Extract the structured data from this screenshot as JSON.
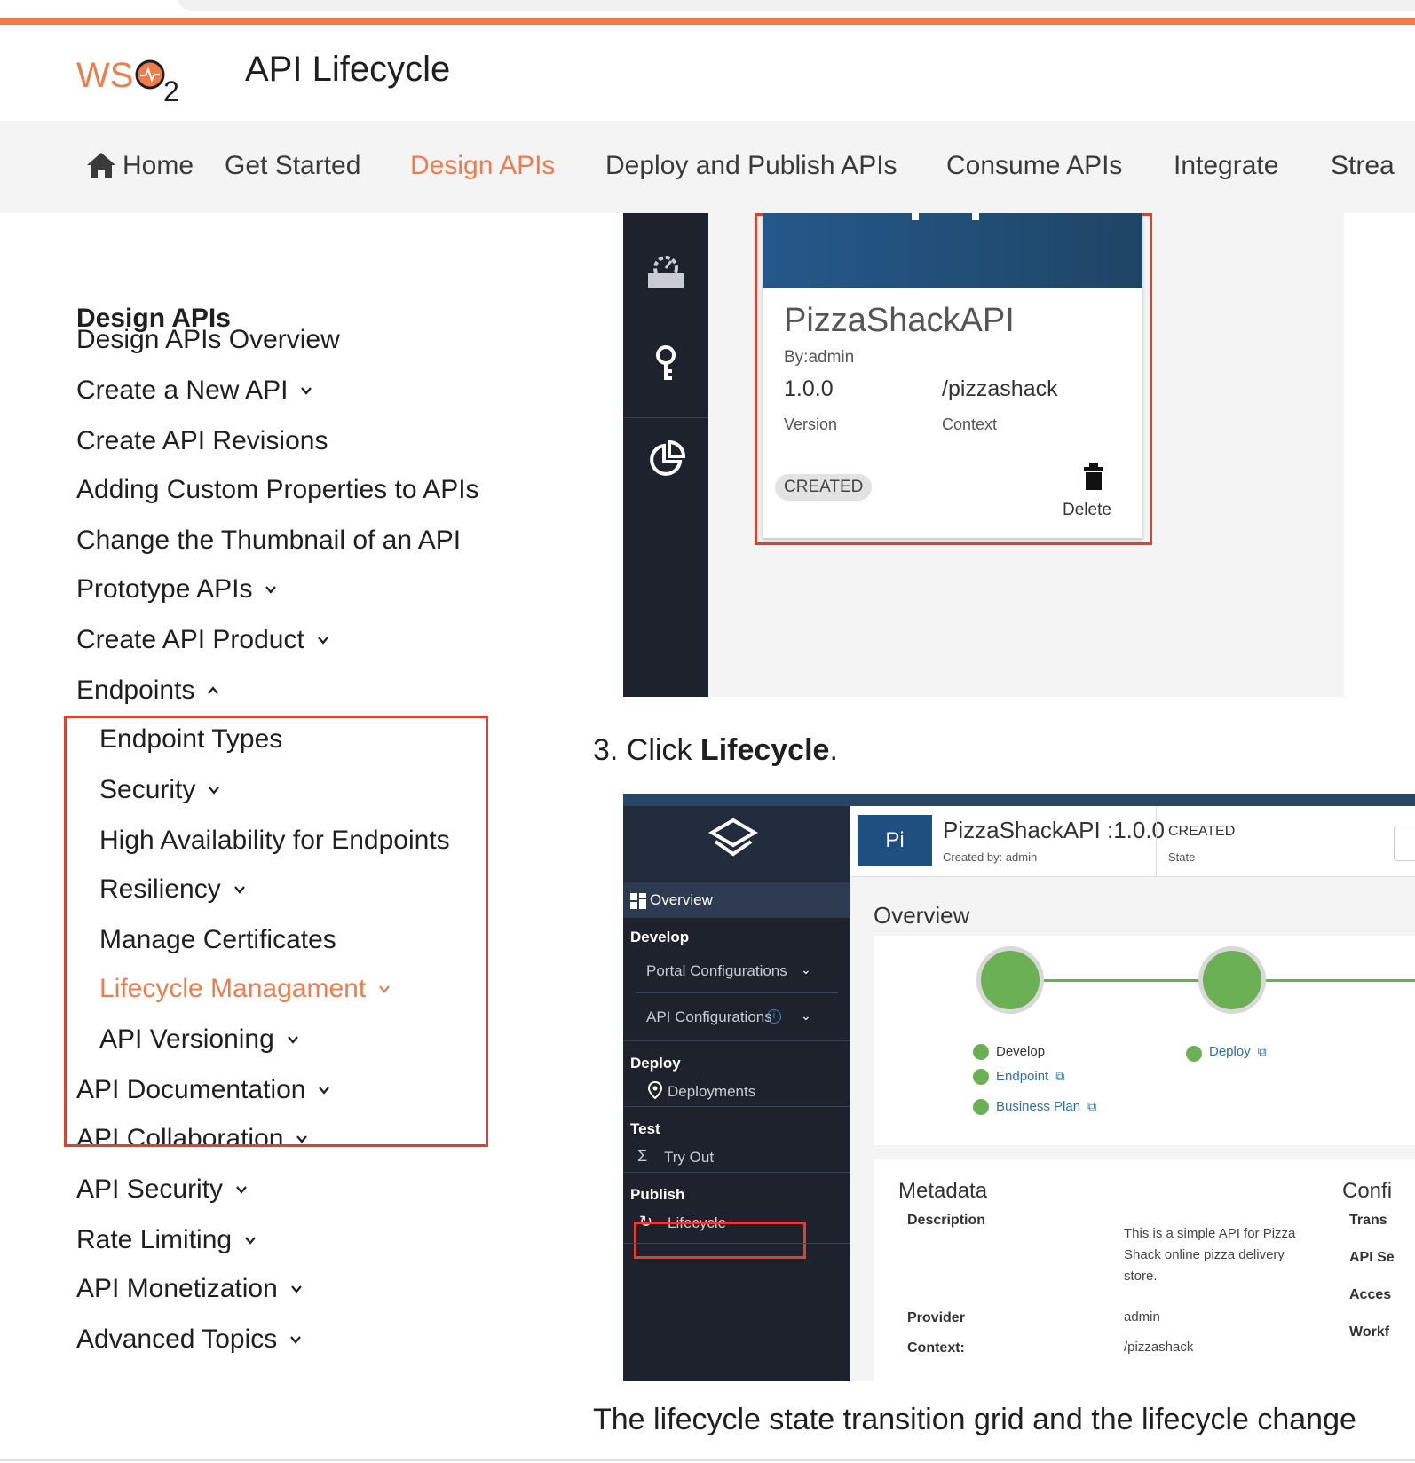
{
  "header": {
    "logo_text": "WSO2",
    "site_title": "API Lifecycle"
  },
  "topnav": {
    "items": [
      {
        "label": "Home"
      },
      {
        "label": "Get Started"
      },
      {
        "label": "Design APIs",
        "active": true
      },
      {
        "label": "Deploy and Publish APIs"
      },
      {
        "label": "Consume APIs"
      },
      {
        "label": "Integrate"
      },
      {
        "label": "Strea"
      }
    ]
  },
  "sidebar": {
    "heading": "Design APIs",
    "items": [
      {
        "label": "Design APIs Overview",
        "chevron": "none"
      },
      {
        "label": "Create a New API",
        "chevron": "down"
      },
      {
        "label": "Create API Revisions",
        "chevron": "none"
      },
      {
        "label": "Adding Custom Properties to APIs",
        "chevron": "none"
      },
      {
        "label": "Change the Thumbnail of an API",
        "chevron": "none"
      },
      {
        "label": "Prototype APIs",
        "chevron": "down"
      },
      {
        "label": "Create API Product",
        "chevron": "down"
      },
      {
        "label": "Endpoints",
        "chevron": "up"
      },
      {
        "label": "Endpoint Types",
        "chevron": "none"
      },
      {
        "label": "Security",
        "chevron": "down"
      },
      {
        "label": "High Availability for Endpoints",
        "chevron": "none"
      },
      {
        "label": "Resiliency",
        "chevron": "down"
      },
      {
        "label": "Manage Certificates",
        "chevron": "none"
      },
      {
        "label": "Lifecycle Managament",
        "chevron": "down",
        "active": true
      },
      {
        "label": "API Versioning",
        "chevron": "down"
      },
      {
        "label": "API Documentation",
        "chevron": "down"
      },
      {
        "label": "API Collaboration",
        "chevron": "down"
      },
      {
        "label": "API Security",
        "chevron": "down"
      },
      {
        "label": "Rate Limiting",
        "chevron": "down"
      },
      {
        "label": "API Monetization",
        "chevron": "down"
      },
      {
        "label": "Advanced Topics",
        "chevron": "down"
      }
    ]
  },
  "screenshot1": {
    "card": {
      "name": "PizzaShackAPI",
      "by": "By:admin",
      "version": "1.0.0",
      "context": "/pizzashack",
      "version_label": "Version",
      "context_label": "Context",
      "status": "CREATED",
      "delete_label": "Delete"
    }
  },
  "step3": {
    "prefix": "3. Click ",
    "bold": "Lifecycle",
    "suffix": "."
  },
  "screenshot2": {
    "sidebar": {
      "overview": "Overview",
      "develop": "Develop",
      "portal_configurations": "Portal Configurations",
      "api_configurations": "API Configurations",
      "deploy": "Deploy",
      "deployments": "Deployments",
      "test": "Test",
      "try_out": "Try Out",
      "publish": "Publish",
      "lifecycle": "Lifecycle"
    },
    "header": {
      "badge": "Pi",
      "title": "PizzaShackAPI :1.0.0",
      "created_by": "Created by: admin",
      "state_value": "CREATED",
      "state_label": "State"
    },
    "overview": {
      "title": "Overview",
      "develop_checks": [
        "Develop",
        "Endpoint",
        "Business Plan"
      ],
      "deploy_checks": [
        "Deploy"
      ]
    },
    "metadata": {
      "title": "Metadata",
      "description_label": "Description",
      "description_value": "This is a simple API for Pizza Shack online pizza delivery store.",
      "provider_label": "Provider",
      "provider_value": "admin",
      "context_label": "Context:",
      "context_value": "/pizzashack"
    },
    "configuration": {
      "title": "Confi",
      "labels": [
        "Trans",
        "API Se",
        "Acces",
        "Workf"
      ]
    }
  },
  "bottom_text": "The lifecycle state transition grid and the lifecycle change",
  "colors": {
    "accent": "#ef7c4b",
    "highlight_box": "#e2402e",
    "status_green": "#6bb055"
  }
}
